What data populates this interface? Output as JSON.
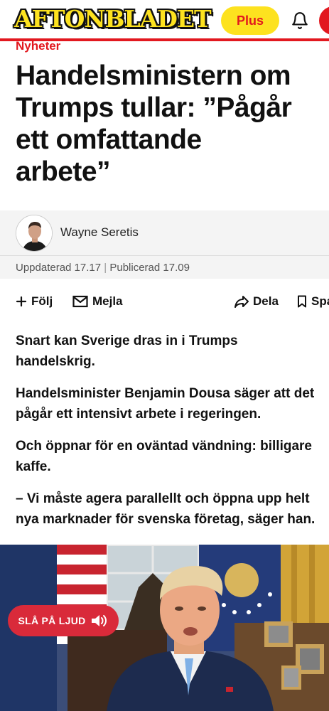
{
  "header": {
    "logo": "AFTONBLADET",
    "plus_label": "Plus"
  },
  "article": {
    "category": "Nyheter",
    "title_lines": [
      "Handelsministern om",
      "Trumps tullar: ”Pågår",
      "ett omfattande",
      "arbete”"
    ],
    "author": "Wayne Seretis",
    "updated": "Uppdaterad 17.17",
    "separator": "|",
    "published": "Publicerad 17.09",
    "paragraphs": [
      [
        "Snart kan Sverige dras in i Trumps",
        "handelskrig."
      ],
      [
        "Handelsminister Benjamin Dousa säger att det",
        "pågår ett intensivt arbete i regeringen."
      ],
      [
        "Och öppnar för en oväntad vändning: billigare",
        "kaffe."
      ],
      [
        "– Vi måste agera parallellt och öppna upp helt",
        "nya marknader för svenska företag, säger han."
      ]
    ]
  },
  "actions": {
    "follow": "Följ",
    "mail": "Mejla",
    "share": "Dela",
    "save": "Spara"
  },
  "media": {
    "sound_label": "SLÅ PÅ LJUD"
  },
  "colors": {
    "brand_red": "#e2181f",
    "brand_yellow": "#fde21f",
    "sound_button": "#d92a3a"
  },
  "icons": [
    "bell-icon",
    "plus-icon",
    "mail-icon",
    "share-icon",
    "bookmark-icon",
    "speaker-icon"
  ]
}
